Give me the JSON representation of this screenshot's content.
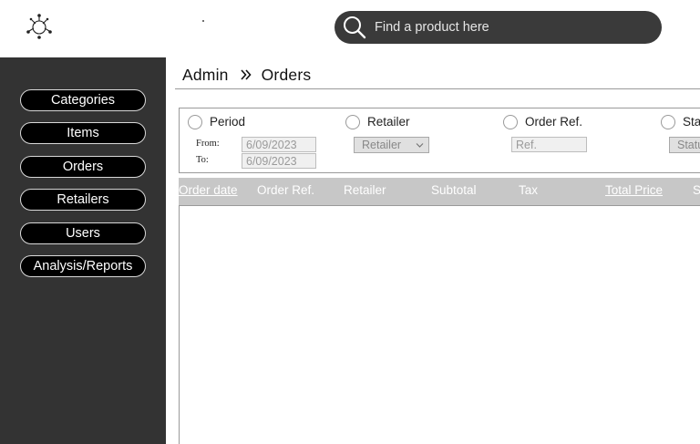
{
  "header": {
    "logo_icon": "decorative-emblem-icon",
    "search": {
      "placeholder": "Find a product here",
      "icon": "search-icon"
    }
  },
  "sidebar": {
    "items": [
      {
        "label": "Categories"
      },
      {
        "label": "Items"
      },
      {
        "label": "Orders"
      },
      {
        "label": "Retailers"
      },
      {
        "label": "Users"
      },
      {
        "label": "Analysis/Reports"
      }
    ]
  },
  "breadcrumb": {
    "root": "Admin",
    "current": "Orders",
    "separator_icon": "double-chevron-right-icon"
  },
  "filters": {
    "period": {
      "label": "Period",
      "from_label": "From:",
      "to_label": "To:",
      "from_value": "6/09/2023",
      "to_value": "6/09/2023"
    },
    "retailer": {
      "label": "Retailer",
      "selected": "Retailer"
    },
    "order_ref": {
      "label": "Order Ref.",
      "placeholder": "Ref."
    },
    "status": {
      "label": "Stat",
      "selected": "Statu"
    }
  },
  "table": {
    "columns": [
      {
        "label": "Order date",
        "sortable": true
      },
      {
        "label": "Order Ref.",
        "sortable": false
      },
      {
        "label": "Retailer",
        "sortable": false
      },
      {
        "label": "Subtotal",
        "sortable": false
      },
      {
        "label": "Tax",
        "sortable": false
      },
      {
        "label": "Total Price",
        "sortable": true
      },
      {
        "label": "S",
        "sortable": false
      }
    ],
    "rows": []
  },
  "colors": {
    "sidebar_bg": "#333333",
    "search_bg": "#3a3a3a",
    "table_header_bg": "#c7c7c7",
    "nav_button_bg": "#000000"
  }
}
